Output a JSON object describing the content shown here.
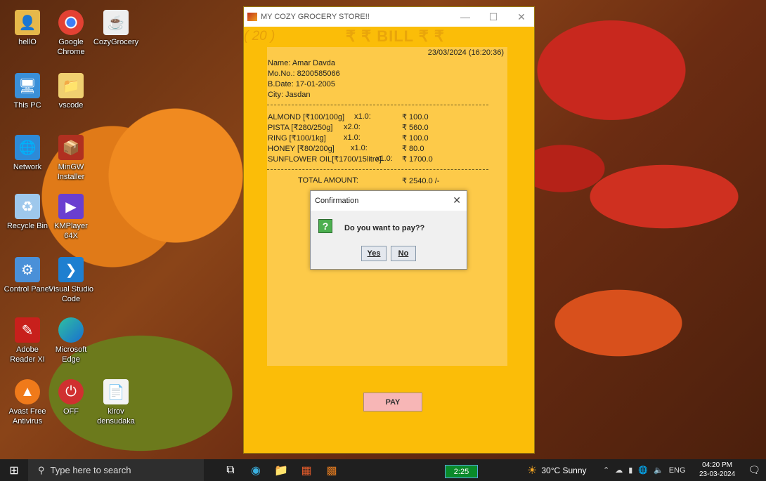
{
  "desktop": {
    "icons": [
      {
        "label": "hellO",
        "icon": "folder-user-icon"
      },
      {
        "label": "Google Chrome",
        "icon": "chrome-icon"
      },
      {
        "label": "CozyGrocery",
        "icon": "java-icon"
      },
      {
        "label": "This PC",
        "icon": "computer-icon"
      },
      {
        "label": "vscode",
        "icon": "folder-icon"
      },
      {
        "label": "Network",
        "icon": "network-icon"
      },
      {
        "label": "MinGW Installer",
        "icon": "installer-icon"
      },
      {
        "label": "Recycle Bin",
        "icon": "recycle-bin-icon"
      },
      {
        "label": "KMPlayer 64X",
        "icon": "kmplayer-icon"
      },
      {
        "label": "Control Panel",
        "icon": "control-panel-icon"
      },
      {
        "label": "Visual Studio Code",
        "icon": "vscode-icon"
      },
      {
        "label": "Adobe Reader XI",
        "icon": "adobe-reader-icon"
      },
      {
        "label": "Microsoft Edge",
        "icon": "edge-icon"
      },
      {
        "label": "Avast Free Antivirus",
        "icon": "avast-icon"
      },
      {
        "label": "OFF",
        "icon": "power-icon"
      },
      {
        "label": "kirov densudaka",
        "icon": "file-icon"
      }
    ]
  },
  "app": {
    "title": "MY COZY GROCERY STORE!!",
    "counter": "( 20 )",
    "bill_heading": "₹ ₹ BILL ₹ ₹",
    "datetime": "23/03/2024 (16:20:36)",
    "customer": {
      "name": "Name: Amar Davda",
      "mobile": "Mo.No.: 8200585066",
      "bdate": "B.Date: 17-01-2005",
      "city": "City: Jasdan"
    },
    "items": [
      {
        "name": "ALMOND [₹100/100g]",
        "qty": "x1.0:",
        "price": "₹ 100.0"
      },
      {
        "name": "PISTA [₹280/250g]",
        "qty": "x2.0:",
        "price": "₹ 560.0"
      },
      {
        "name": "RING [₹100/1kg]",
        "qty": "x1.0:",
        "price": "₹ 100.0"
      },
      {
        "name": "HONEY [₹80/200g]",
        "qty": "x1.0:",
        "price": "₹ 80.0"
      },
      {
        "name": "SUNFLOWER OIL[₹1700/15litre]",
        "qty": "x1.0:",
        "price": "₹ 1700.0"
      }
    ],
    "total_label": "TOTAL AMOUNT:",
    "total_value": "₹ 2540.0 /-",
    "pay_label": "PAY"
  },
  "dialog": {
    "title": "Confirmation",
    "message": "Do you want to pay??",
    "yes": "Yes",
    "no": "No"
  },
  "taskbar": {
    "search_placeholder": "Type here to search",
    "timer": "2:25",
    "weather": "30°C  Sunny",
    "lang": "ENG",
    "time": "04:20 PM",
    "date": "23-03-2024"
  },
  "colors": {
    "window_bg": "#fbbd08",
    "panel_bg": "#fdca49",
    "pay_button": "#f7b6b6"
  }
}
